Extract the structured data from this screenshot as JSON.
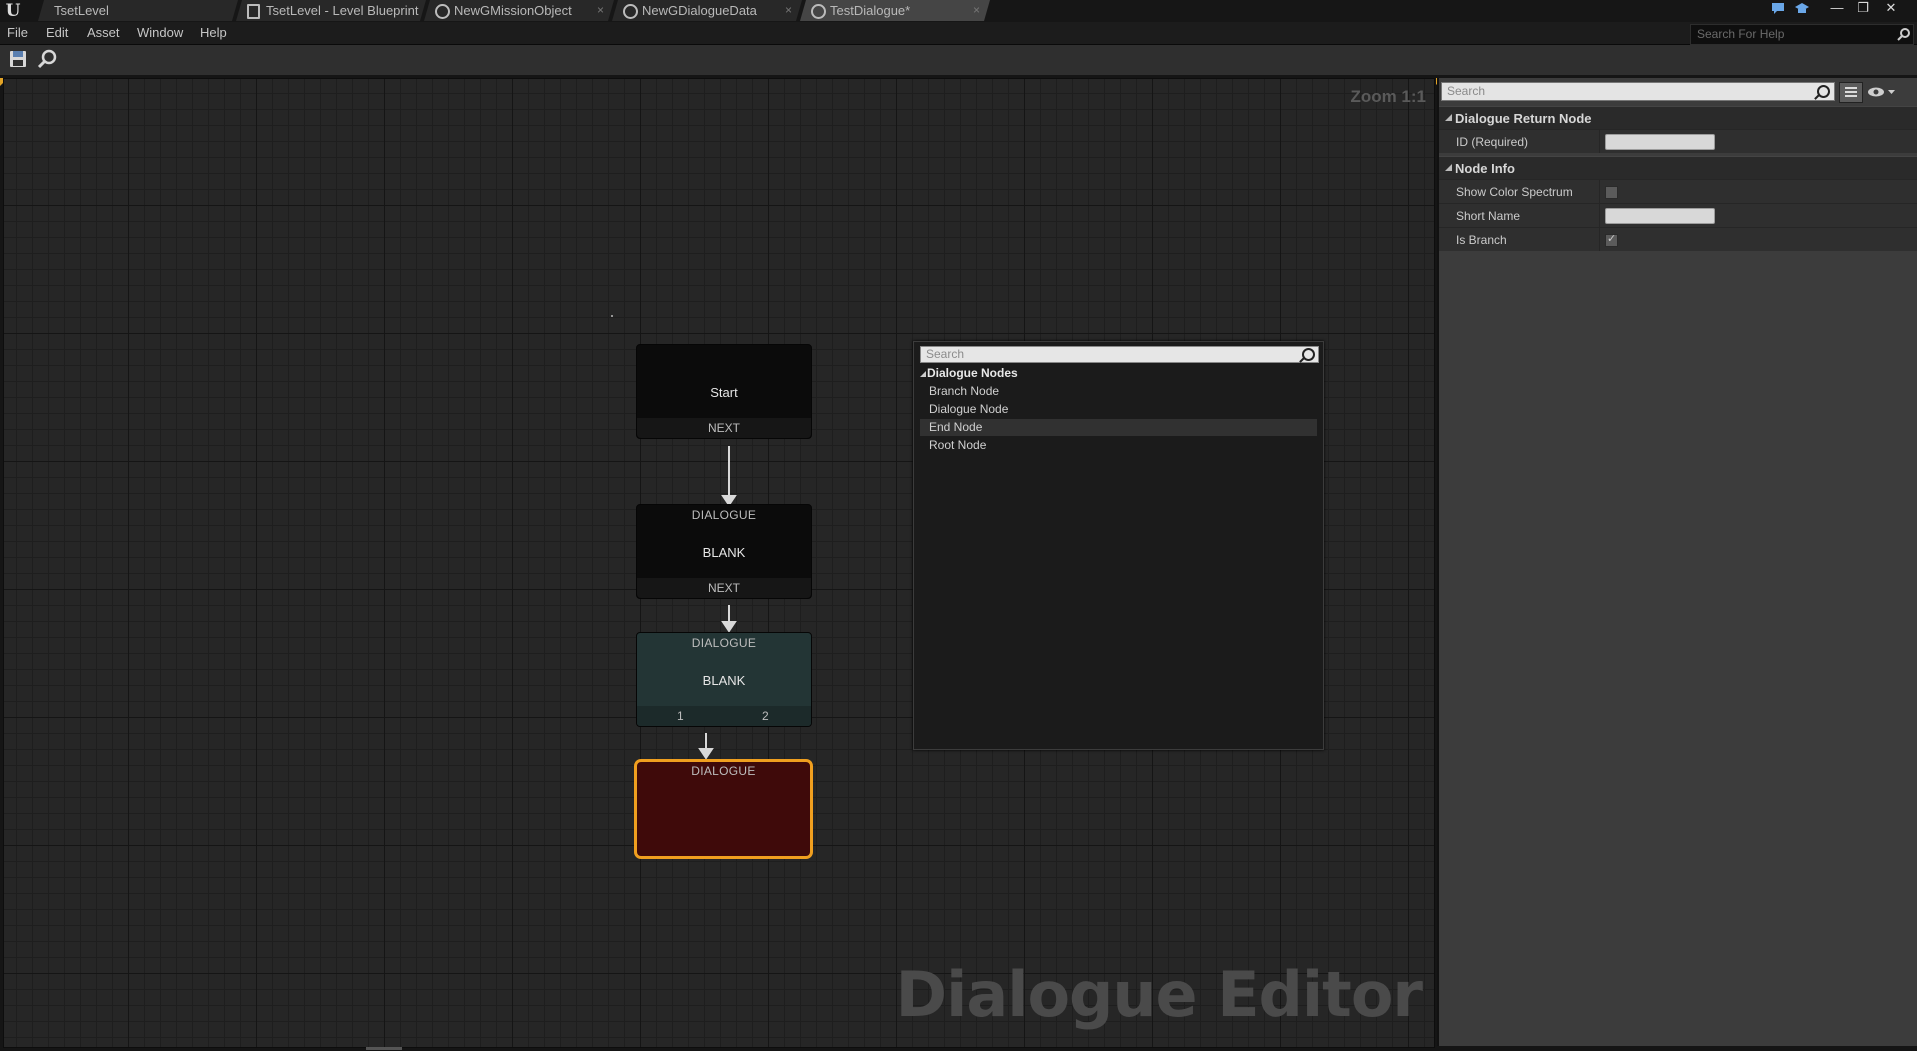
{
  "tabs": [
    {
      "label": "TsetLevel",
      "icon": "unreal-level-icon"
    },
    {
      "label": "TsetLevel - Level Blueprint",
      "icon": "blueprint-document-icon"
    },
    {
      "label": "NewGMissionObject",
      "icon": "asset-circle-icon"
    },
    {
      "label": "NewGDialogueData",
      "icon": "asset-circle-icon"
    },
    {
      "label": "TestDialogue*",
      "icon": "asset-circle-icon"
    }
  ],
  "menu": [
    "File",
    "Edit",
    "Asset",
    "Window",
    "Help"
  ],
  "help_search": {
    "placeholder": "Search For Help"
  },
  "toolbar": {
    "save_icon": "save-icon",
    "browse_icon": "find-in-browser-icon"
  },
  "graph": {
    "zoom": "Zoom 1:1",
    "watermark": "Dialogue Editor",
    "nodes": {
      "start": {
        "body": "Start",
        "footer": "NEXT"
      },
      "dialogue1": {
        "header": "DIALOGUE",
        "body": "BLANK",
        "footer": "NEXT"
      },
      "branch": {
        "header": "DIALOGUE",
        "body": "BLANK",
        "pin1": "1",
        "pin2": "2"
      },
      "selected": {
        "header": "DIALOGUE"
      }
    }
  },
  "context_menu": {
    "search_placeholder": "Search",
    "category": "Dialogue Nodes",
    "items": [
      "Branch Node",
      "Dialogue Node",
      "End Node",
      "Root Node"
    ],
    "highlighted": "End Node"
  },
  "details": {
    "search_placeholder": "Search",
    "sections": [
      {
        "title": "Dialogue Return Node",
        "props": [
          {
            "label": "ID (Required)",
            "type": "text",
            "value": ""
          }
        ]
      },
      {
        "title": "Node Info",
        "props": [
          {
            "label": "Show Color Spectrum",
            "type": "checkbox",
            "checked": false
          },
          {
            "label": "Short Name",
            "type": "text",
            "value": ""
          },
          {
            "label": "Is Branch",
            "type": "checkbox",
            "checked": true
          }
        ]
      }
    ]
  },
  "colors": {
    "selection_outline": "#f09f1f",
    "selected_node_fill": "#3f0a0a",
    "branch_node_fill": "#233535",
    "accent_corner": "#e2a326"
  }
}
